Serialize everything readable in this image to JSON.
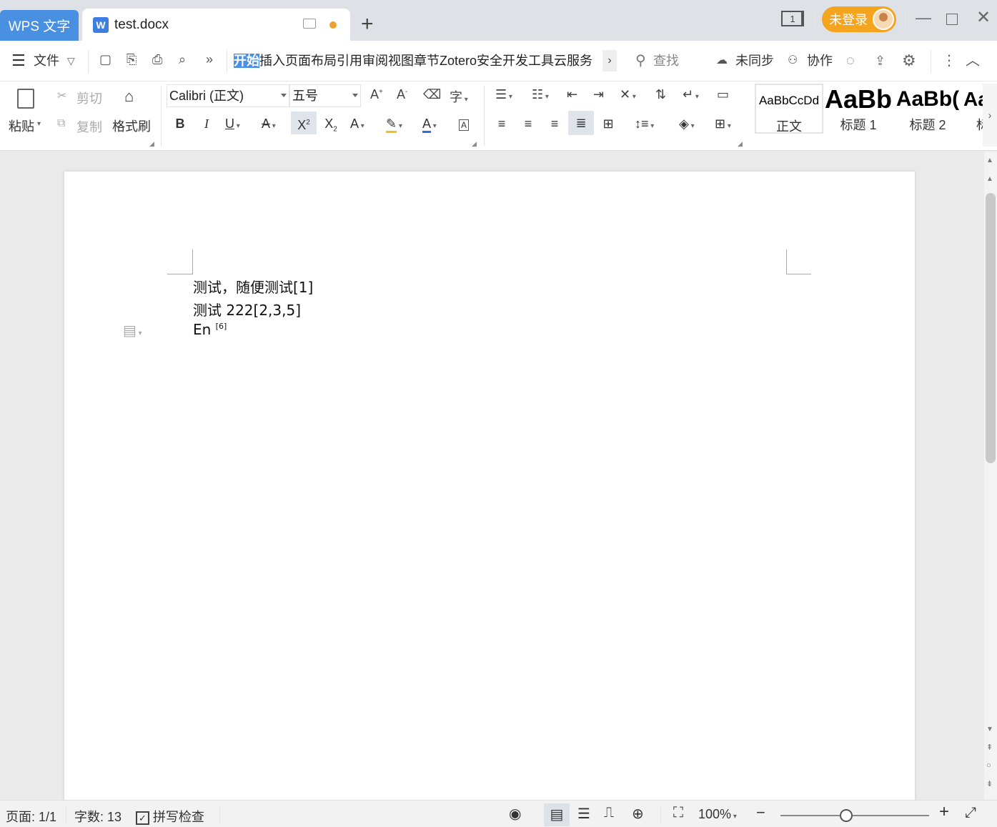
{
  "titlebar": {
    "app_tab": "WPS 文字",
    "doc_tab": "test.docx",
    "window_count": "1",
    "login": "未登录"
  },
  "menubar": {
    "file": "文件",
    "ribbon_tabs": [
      "开始",
      "插入",
      "页面布局",
      "引用",
      "审阅",
      "视图",
      "章节",
      "Zotero",
      "安全",
      "开发工具",
      "云服务"
    ],
    "search": "查找",
    "sync": "未同步",
    "collab": "协作"
  },
  "ribbon": {
    "paste": "粘贴",
    "cut": "剪切",
    "copy": "复制",
    "format_painter": "格式刷",
    "font_name": "Calibri (正文)",
    "font_size": "五号",
    "styles": [
      {
        "preview": "AaBbCcDd",
        "name": "正文"
      },
      {
        "preview": "AaBb",
        "name": "标题 1"
      },
      {
        "preview": "AaBb(",
        "name": "标题 2"
      },
      {
        "preview": "Aa",
        "name": "标"
      }
    ]
  },
  "document": {
    "line1": "测试，随便测试[1]",
    "line2": "测试 222[2,3,5]",
    "line3_text": "En ",
    "line3_sup": "[6]"
  },
  "status": {
    "page": "页面: 1/1",
    "words": "字数: 13",
    "spell": "拼写检查",
    "zoom": "100%",
    "zoom_level": 0.44
  }
}
